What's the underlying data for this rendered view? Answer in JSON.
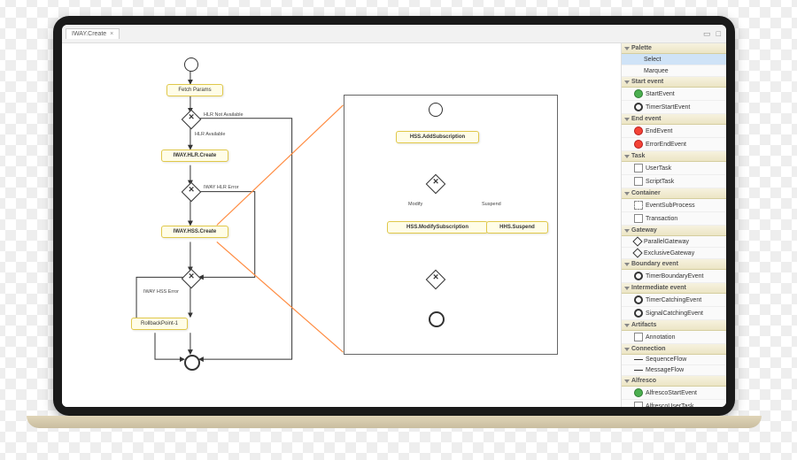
{
  "tab": {
    "title": "IWAY.Create",
    "close": "×"
  },
  "window_icons": [
    "▭",
    "□",
    "▬"
  ],
  "canvas": {
    "nodes": {
      "fetch": "Fetch Params",
      "hlr": "IWAY.HLR.Create",
      "hss": "IWAY.HSS.Create",
      "rollback": "RollbackPoint-1"
    },
    "labels": {
      "hlr_na": "HLR Not Available",
      "hlr_av": "HLR Available",
      "hlr_err": "IWAY HLR Error",
      "hss_err": "IWAY HSS Error"
    },
    "detail": {
      "add": "HSS.AddSubscription",
      "modify_node": "HSS.ModifySubscription",
      "suspend": "HHS.Suspend",
      "modify_lbl": "Modify",
      "suspend_lbl": "Suspend"
    }
  },
  "palette": {
    "title": "Palette",
    "groups": [
      {
        "name": "",
        "items": [
          {
            "k": "select",
            "t": "Select",
            "sel": true
          },
          {
            "k": "marquee",
            "t": "Marquee"
          }
        ]
      },
      {
        "name": "Start event",
        "items": [
          {
            "k": "startevent",
            "t": "StartEvent",
            "i": "green"
          },
          {
            "k": "timerstart",
            "t": "TimerStartEvent",
            "i": "ring"
          }
        ]
      },
      {
        "name": "End event",
        "items": [
          {
            "k": "endevent",
            "t": "EndEvent",
            "i": "red"
          },
          {
            "k": "errorend",
            "t": "ErrorEndEvent",
            "i": "red"
          }
        ]
      },
      {
        "name": "Task",
        "items": [
          {
            "k": "usertask",
            "t": "UserTask",
            "i": "sq"
          },
          {
            "k": "scripttask",
            "t": "ScriptTask",
            "i": "sq"
          }
        ]
      },
      {
        "name": "Container",
        "items": [
          {
            "k": "eventsub",
            "t": "EventSubProcess",
            "i": "dash"
          },
          {
            "k": "transaction",
            "t": "Transaction",
            "i": "sq"
          }
        ]
      },
      {
        "name": "Gateway",
        "items": [
          {
            "k": "parallel",
            "t": "ParallelGateway",
            "i": "diam"
          },
          {
            "k": "exclusive",
            "t": "ExclusiveGateway",
            "i": "diam"
          }
        ]
      },
      {
        "name": "Boundary event",
        "items": [
          {
            "k": "timerbound",
            "t": "TimerBoundaryEvent",
            "i": "ring"
          }
        ]
      },
      {
        "name": "Intermediate event",
        "items": [
          {
            "k": "timercatch",
            "t": "TimerCatchingEvent",
            "i": "ring"
          },
          {
            "k": "signalcatch",
            "t": "SignalCatchingEvent",
            "i": "ring"
          }
        ]
      },
      {
        "name": "Artifacts",
        "items": [
          {
            "k": "annotation",
            "t": "Annotation",
            "i": "sq"
          }
        ]
      },
      {
        "name": "Connection",
        "items": [
          {
            "k": "seqflow",
            "t": "SequenceFlow",
            "i": "line"
          },
          {
            "k": "msgflow",
            "t": "MessageFlow",
            "i": "line"
          }
        ]
      },
      {
        "name": "Alfresco",
        "items": [
          {
            "k": "alfstart",
            "t": "AlfrescoStartEvent",
            "i": "green"
          },
          {
            "k": "alfuser",
            "t": "AlfrescoUserTask",
            "i": "sq"
          }
        ]
      }
    ]
  }
}
